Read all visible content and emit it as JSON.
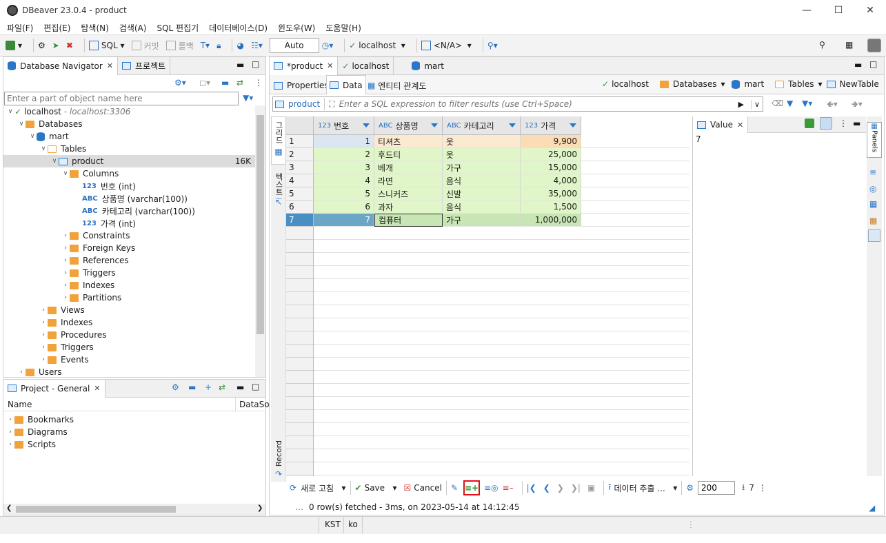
{
  "window": {
    "title": "DBeaver 23.0.4 - product"
  },
  "menu": [
    "파일(F)",
    "편집(E)",
    "탐색(N)",
    "검색(A)",
    "SQL 편집기",
    "데이터베이스(D)",
    "윈도우(W)",
    "도움말(H)"
  ],
  "toolbar": {
    "sql": "SQL",
    "commit": "커밋",
    "rollback": "롤백",
    "tx_mode": "Auto",
    "connection": "localhost",
    "schema": "N/A"
  },
  "left": {
    "nav_tab": "Database Navigator",
    "project_tab": "프로젝트",
    "filter_placeholder": "Enter a part of object name here",
    "tree": {
      "localhost": "localhost",
      "localhost_hint": "- localhost:3306",
      "databases": "Databases",
      "mart": "mart",
      "tables": "Tables",
      "product": "product",
      "product_size": "16K",
      "columns": "Columns",
      "cols": [
        {
          "type": "123",
          "label": "번호 (int)"
        },
        {
          "type": "ABC",
          "label": "상품명 (varchar(100))"
        },
        {
          "type": "ABC",
          "label": "카테고리 (varchar(100))"
        },
        {
          "type": "123",
          "label": "가격 (int)"
        }
      ],
      "table_children": [
        "Constraints",
        "Foreign Keys",
        "References",
        "Triggers",
        "Indexes",
        "Partitions"
      ],
      "db_children": [
        "Views",
        "Indexes",
        "Procedures",
        "Triggers",
        "Events"
      ],
      "users": "Users"
    },
    "project_panel": {
      "tab": "Project - General",
      "col_name": "Name",
      "col_datasource": "DataSo",
      "items": [
        "Bookmarks",
        "Diagrams",
        "Scripts"
      ]
    }
  },
  "editor": {
    "tabs": [
      "*product",
      "localhost",
      "mart"
    ],
    "subtabs": [
      "Properties",
      "Data",
      "엔티티 관계도"
    ],
    "breadcrumb": [
      "localhost",
      "Databases",
      "mart",
      "Tables",
      "NewTable"
    ],
    "filter_label": "product",
    "filter_placeholder": "Enter a SQL expression to filter results (use Ctrl+Space)",
    "side_labels": {
      "grid": "그리드",
      "text": "텍스트",
      "record": "Record"
    },
    "columns": [
      {
        "type": "123",
        "name": "번호"
      },
      {
        "type": "ABC",
        "name": "상품명"
      },
      {
        "type": "ABC",
        "name": "카테고리"
      },
      {
        "type": "123",
        "name": "가격"
      }
    ],
    "rows": [
      [
        "1",
        "1",
        "티셔츠",
        "옷",
        "9,900"
      ],
      [
        "2",
        "2",
        "후드티",
        "옷",
        "25,000"
      ],
      [
        "3",
        "3",
        "베개",
        "가구",
        "15,000"
      ],
      [
        "4",
        "4",
        "라면",
        "음식",
        "4,000"
      ],
      [
        "5",
        "5",
        "스니커즈",
        "신발",
        "35,000"
      ],
      [
        "6",
        "6",
        "과자",
        "음식",
        "1,500"
      ],
      [
        "7",
        "7",
        "컴퓨터",
        "가구",
        "1,000,000"
      ]
    ],
    "value_panel": {
      "tab": "Value",
      "value": "7"
    },
    "panels_label": "Panels",
    "bottom": {
      "refresh": "새로 고침",
      "save": "Save",
      "cancel": "Cancel",
      "export": "데이터 추출 ...",
      "fetch_size": "200",
      "row_count": "7",
      "status": "0 row(s) fetched - 3ms, on 2023-05-14 at 14:12:45"
    }
  },
  "statusbar": {
    "tz": "KST",
    "locale": "ko"
  }
}
